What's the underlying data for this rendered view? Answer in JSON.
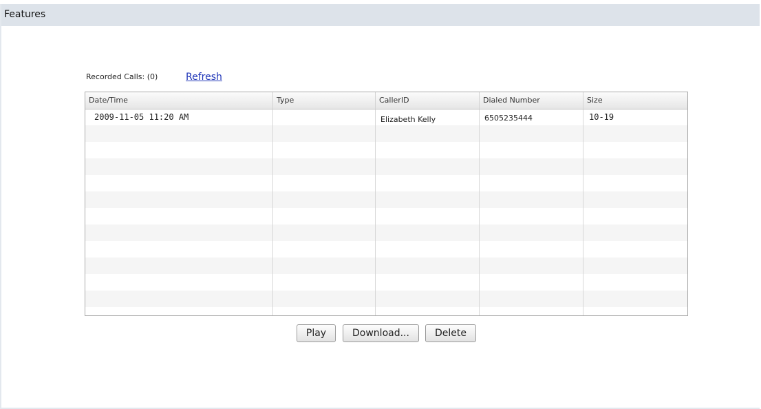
{
  "panel": {
    "title": "Features"
  },
  "recorded": {
    "label": "Recorded Calls: (0)",
    "refresh_label": "Refresh"
  },
  "table": {
    "columns": [
      "Date/Time",
      "Type",
      "CallerID",
      "Dialed Number",
      "Size"
    ],
    "rows": [
      {
        "datetime": "2009-11-05 11:20 AM",
        "type": "",
        "callerid": "Elizabeth Kelly",
        "dialed": "6505235444",
        "size": "10-19"
      }
    ]
  },
  "buttons": {
    "play": "Play",
    "download": "Download...",
    "delete": "Delete"
  }
}
